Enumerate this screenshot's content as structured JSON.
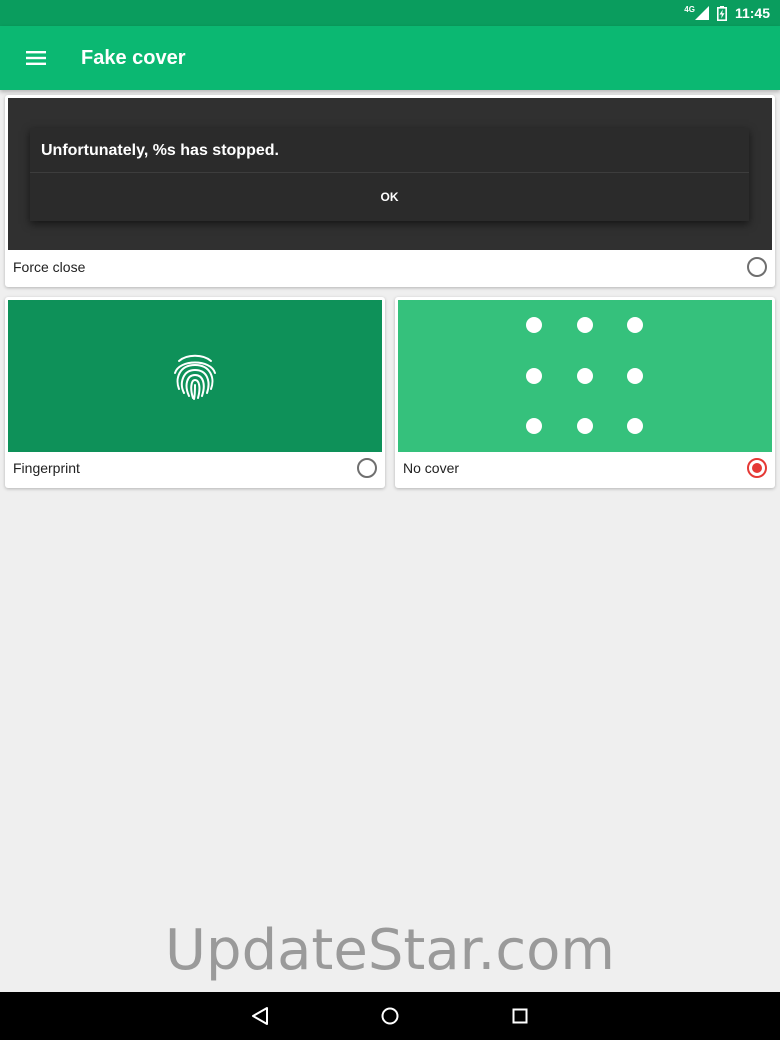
{
  "status_bar": {
    "network": "4G",
    "time": "11:45"
  },
  "app_bar": {
    "title": "Fake cover",
    "menu_icon": "hamburger-menu-icon"
  },
  "covers": [
    {
      "label": "Force close",
      "selected": false,
      "dialog_message": "Unfortunately, %s has stopped.",
      "dialog_button": "OK"
    },
    {
      "label": "Fingerprint",
      "selected": false,
      "icon": "fingerprint-icon"
    },
    {
      "label": "No cover",
      "selected": true,
      "icon": "pattern-dots-icon"
    }
  ],
  "watermark": "UpdateStar.com",
  "colors": {
    "status_bar": "#0a9d5e",
    "app_bar": "#0bb872",
    "fingerprint_bg": "#0e9159",
    "no_cover_bg": "#35c17c",
    "radio_selected": "#e53935"
  },
  "nav_bar": {
    "back_icon": "back-triangle-icon",
    "home_icon": "home-circle-icon",
    "recents_icon": "recents-square-icon"
  }
}
